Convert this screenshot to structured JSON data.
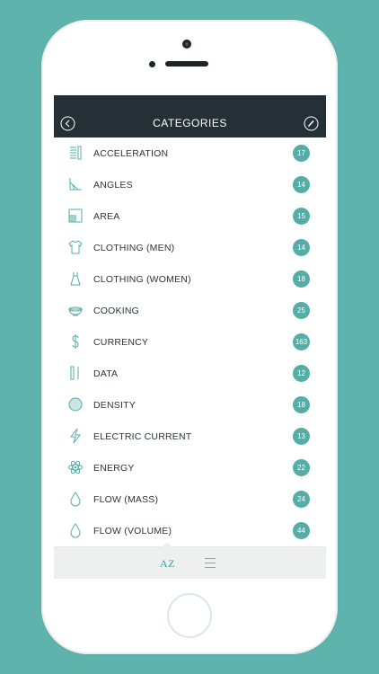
{
  "header": {
    "title": "CATEGORIES"
  },
  "toolbar": {
    "az_label": "AZ"
  },
  "colors": {
    "accent": "#55ada7",
    "navbar": "#243036",
    "background": "#5fb3ad"
  },
  "categories": [
    {
      "label": "ACCELERATION",
      "count": "17",
      "icon": "acceleration-icon"
    },
    {
      "label": "ANGLES",
      "count": "14",
      "icon": "angle-icon"
    },
    {
      "label": "AREA",
      "count": "15",
      "icon": "area-icon"
    },
    {
      "label": "CLOTHING (MEN)",
      "count": "14",
      "icon": "tshirt-icon"
    },
    {
      "label": "CLOTHING (WOMEN)",
      "count": "18",
      "icon": "dress-icon"
    },
    {
      "label": "COOKING",
      "count": "25",
      "icon": "bowl-icon"
    },
    {
      "label": "CURRENCY",
      "count": "163",
      "icon": "dollar-icon"
    },
    {
      "label": "DATA",
      "count": "12",
      "icon": "data-bars-icon"
    },
    {
      "label": "DENSITY",
      "count": "18",
      "icon": "density-circle-icon"
    },
    {
      "label": "ELECTRIC CURRENT",
      "count": "13",
      "icon": "lightning-icon"
    },
    {
      "label": "ENERGY",
      "count": "22",
      "icon": "atom-icon"
    },
    {
      "label": "FLOW (MASS)",
      "count": "24",
      "icon": "droplet-icon"
    },
    {
      "label": "FLOW (VOLUME)",
      "count": "44",
      "icon": "droplet-icon"
    }
  ]
}
